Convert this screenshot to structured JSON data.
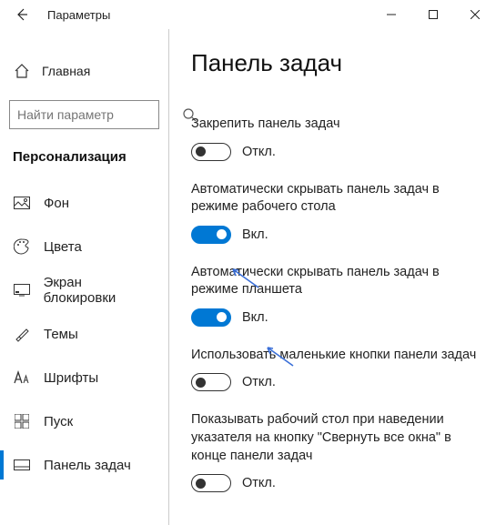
{
  "window": {
    "title": "Параметры"
  },
  "sidebar": {
    "home": "Главная",
    "search_placeholder": "Найти параметр",
    "section": "Персонализация",
    "items": [
      {
        "label": "Фон"
      },
      {
        "label": "Цвета"
      },
      {
        "label": "Экран блокировки"
      },
      {
        "label": "Темы"
      },
      {
        "label": "Шрифты"
      },
      {
        "label": "Пуск"
      },
      {
        "label": "Панель задач"
      }
    ]
  },
  "content": {
    "title": "Панель задач",
    "settings": [
      {
        "label": "Закрепить панель задач",
        "on": false
      },
      {
        "label": "Автоматически скрывать панель задач в режиме рабочего стола",
        "on": true
      },
      {
        "label": "Автоматически скрывать панель задач в режиме планшета",
        "on": true
      },
      {
        "label": "Использовать маленькие кнопки панели задач",
        "on": false
      },
      {
        "label": "Показывать рабочий стол при наведении указателя на кнопку \"Свернуть все окна\" в конце панели задач",
        "on": false
      }
    ],
    "state_on": "Вкл.",
    "state_off": "Откл."
  }
}
